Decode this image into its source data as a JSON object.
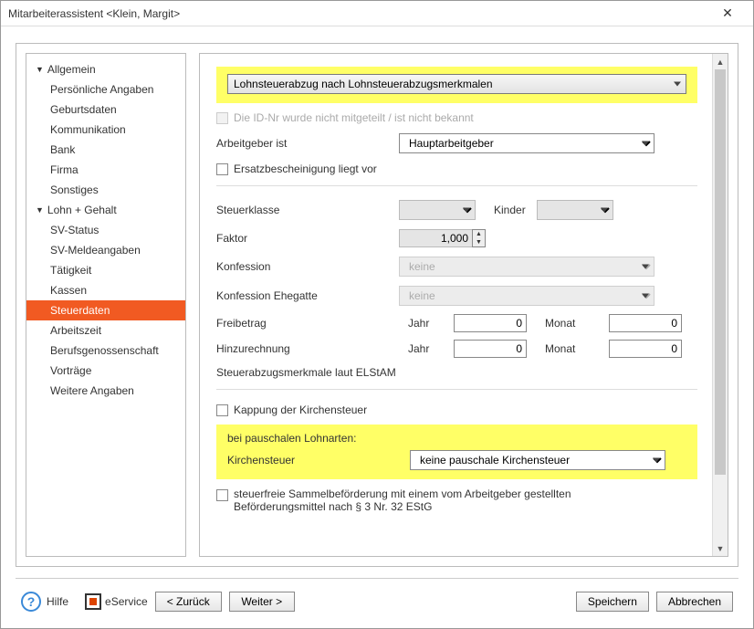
{
  "window": {
    "title": "Mitarbeiterassistent <Klein, Margit>"
  },
  "sidebar": {
    "groups": [
      {
        "label": "Allgemein",
        "items": [
          "Persönliche Angaben",
          "Geburtsdaten",
          "Kommunikation",
          "Bank",
          "Firma",
          "Sonstiges"
        ]
      },
      {
        "label": "Lohn + Gehalt",
        "items": [
          "SV-Status",
          "SV-Meldeangaben",
          "Tätigkeit",
          "Kassen",
          "Steuerdaten",
          "Arbeitszeit",
          "Berufsgenossenschaft",
          "Vorträge",
          "Weitere Angaben"
        ],
        "selected": "Steuerdaten"
      }
    ]
  },
  "form": {
    "lohnsteuer_mode": "Lohnsteuerabzug nach Lohnsteuerabzugsmerkmalen",
    "id_unknown_label": "Die ID-Nr wurde nicht mitgeteilt / ist nicht bekannt",
    "arbeitgeber_label": "Arbeitgeber ist",
    "arbeitgeber_value": "Hauptarbeitgeber",
    "ersatz_label": "Ersatzbescheinigung liegt vor",
    "steuerklasse_label": "Steuerklasse",
    "kinder_label": "Kinder",
    "faktor_label": "Faktor",
    "faktor_value": "1,000",
    "konfession_label": "Konfession",
    "konfession_value": "keine",
    "konfession_eg_label": "Konfession Ehegatte",
    "konfession_eg_value": "keine",
    "freibetrag_label": "Freibetrag",
    "hinzurechnung_label": "Hinzurechnung",
    "jahr_label": "Jahr",
    "monat_label": "Monat",
    "jahr_val": "0",
    "monat_val": "0",
    "elstam_label": "Steuerabzugsmerkmale laut ELStAM",
    "kappung_label": "Kappung der Kirchensteuer",
    "pausch_header": "bei pauschalen Lohnarten:",
    "kirchensteuer_label": "Kirchensteuer",
    "kirchensteuer_value": "keine pauschale Kirchensteuer",
    "sammel_label": "steuerfreie Sammelbeförderung mit einem vom Arbeitgeber gestellten Beförderungsmittel nach § 3 Nr. 32 EStG"
  },
  "footer": {
    "help": "Hilfe",
    "eservice": "eService",
    "back": "< Zurück",
    "next": "Weiter >",
    "save": "Speichern",
    "cancel": "Abbrechen"
  }
}
